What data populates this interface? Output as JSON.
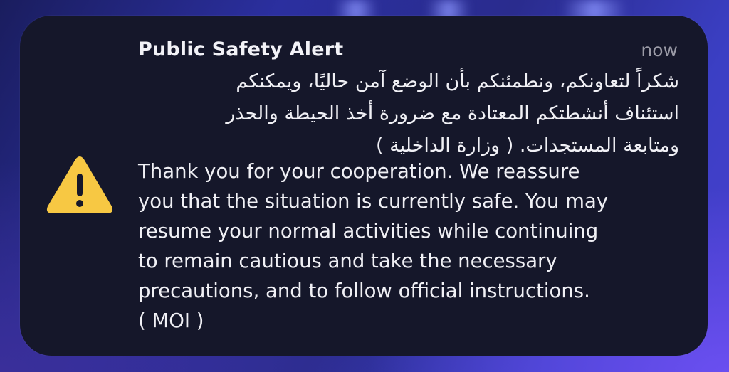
{
  "notification": {
    "title": "Public Safety Alert",
    "time": "now",
    "icon": "warning-triangle-icon",
    "message_arabic": "شكراً لتعاونكم، ونطمئنكم بأن الوضع آمن حاليًا، ويمكنكم\nاستئناف أنشطتكم المعتادة مع ضرورة أخذ الحيطة والحذر\nومتابعة المستجدات. ( وزارة الداخلية )",
    "message_english": "Thank you for your cooperation. We reassure\nyou that the situation is currently safe. You may\nresume your normal activities while continuing\nto remain cautious and take the necessary\nprecautions, and to follow official instructions.\n( MOI  )"
  },
  "colors": {
    "card_background": "#15172a",
    "icon_yellow": "#f7c843",
    "title_text": "#f2f2f7",
    "time_text": "#9a9aa6"
  }
}
